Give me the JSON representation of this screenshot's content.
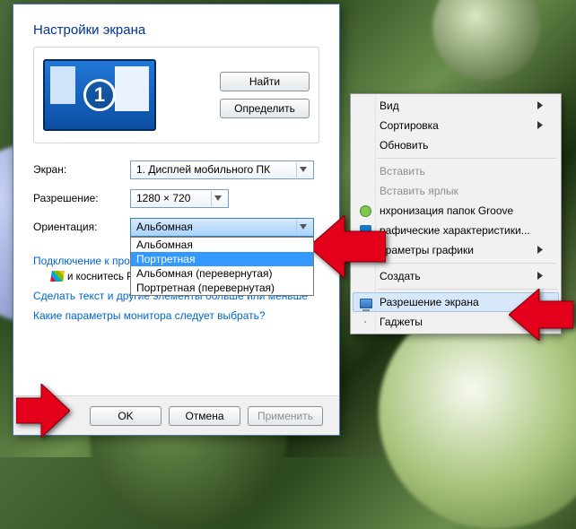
{
  "dialog": {
    "title": "Настройки экрана",
    "monitor_number": "1",
    "find_btn": "Найти",
    "detect_btn": "Определить",
    "screen_label": "Экран:",
    "screen_value": "1. Дисплей мобильного ПК",
    "resolution_label": "Разрешение:",
    "resolution_value": "1280 × 720",
    "orientation_label": "Ориентация:",
    "orientation_value": "Альбомная",
    "orientation_options": [
      "Альбомная",
      "Портретная",
      "Альбомная (перевернутая)",
      "Портретная (перевернутая)"
    ],
    "orientation_selected_index": 1,
    "link_projector": "Подключение к проек",
    "projector_hint": "и коснитесь P)",
    "link_textsize": "Сделать текст и другие элементы больше или меньше",
    "link_whichparams": "Какие параметры монитора следует выбрать?",
    "ok": "OK",
    "cancel": "Отмена",
    "apply": "Применить"
  },
  "context_menu": {
    "items": [
      {
        "label": "Вид",
        "submenu": true
      },
      {
        "label": "Сортировка",
        "submenu": true
      },
      {
        "label": "Обновить"
      },
      {
        "sep": true
      },
      {
        "label": "Вставить",
        "disabled": true
      },
      {
        "label": "Вставить ярлык",
        "disabled": true
      },
      {
        "label": "нхронизация папок Groove",
        "icon": "sync"
      },
      {
        "label": "рафические характеристики...",
        "icon": "intel"
      },
      {
        "label": "араметры графики",
        "icon": "nv",
        "submenu": true
      },
      {
        "sep": true
      },
      {
        "label": "Создать",
        "submenu": true
      },
      {
        "sep": true
      },
      {
        "label": "Разрешение экрана",
        "icon": "monitor",
        "hover": true
      },
      {
        "label": "Гаджеты",
        "icon": "gadget"
      }
    ]
  }
}
